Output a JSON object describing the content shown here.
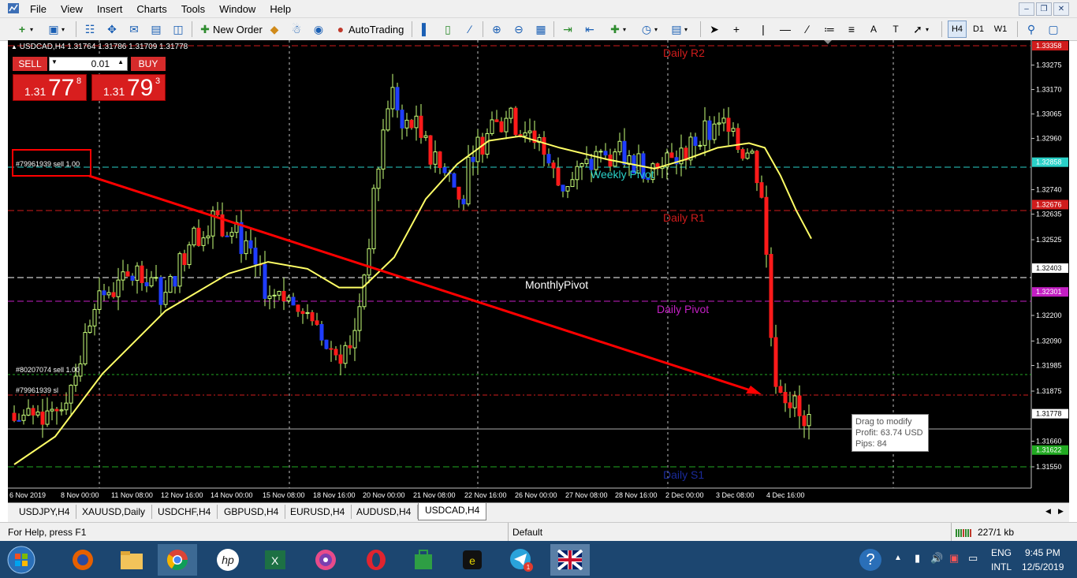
{
  "menu": [
    "File",
    "View",
    "Insert",
    "Charts",
    "Tools",
    "Window",
    "Help"
  ],
  "toolbar": {
    "new_order": "New Order",
    "autotrading": "AutoTrading",
    "timeframes": [
      "H4",
      "D1",
      "W1"
    ]
  },
  "chart": {
    "header": "USDCAD,H4  1.31764 1.31786 1.31709 1.31778",
    "trade_panel": {
      "sell_label": "SELL",
      "buy_label": "BUY",
      "lot": "0.01",
      "sell_small": "1.31",
      "sell_big": "77",
      "sell_sup": "8",
      "buy_small": "1.31",
      "buy_big": "79",
      "buy_sup": "3"
    },
    "order_labels": {
      "sell1": "#79961939 sell 1.00",
      "sell2": "#80207074 sell 1.00",
      "sl": "#79961939 sl"
    },
    "level_labels": {
      "daily_r2": "Daily R2",
      "weekly_pivot": "Weekly Pivot",
      "daily_r1": "Daily R1",
      "monthly_pivot": "MonthlyPivot",
      "daily_pivot": "Daily Pivot",
      "daily_s1": "Daily S1"
    },
    "price_axis": [
      "1.33358",
      "1.33275",
      "1.33170",
      "1.33065",
      "1.32960",
      "1.32858",
      "1.32740",
      "1.32676",
      "1.32635",
      "1.32525",
      "1.32403",
      "1.32301",
      "1.32200",
      "1.32090",
      "1.31985",
      "1.31875",
      "1.31778",
      "1.31660",
      "1.31622",
      "1.31550"
    ],
    "time_axis": [
      "6 Nov 2019",
      "8 Nov 00:00",
      "11 Nov 08:00",
      "12 Nov 16:00",
      "14 Nov 00:00",
      "15 Nov 08:00",
      "18 Nov 16:00",
      "20 Nov 00:00",
      "21 Nov 08:00",
      "22 Nov 16:00",
      "26 Nov 00:00",
      "27 Nov 08:00",
      "28 Nov 16:00",
      "2 Dec 00:00",
      "3 Dec 08:00",
      "4 Dec 16:00"
    ],
    "tooltip": {
      "line1": "Drag to modify",
      "line2": "Profit: 63.74 USD",
      "line3": "Pips: 84"
    },
    "colors": {
      "background": "#000000",
      "bull": "#c8ff7a",
      "bear_red": "#ff1a1a",
      "bear_blue": "#1f3dff",
      "ma": "#ffff66",
      "arrow": "#ff0000",
      "r_levels": "#d01c1c",
      "daily_pivot": "#c31fc3",
      "weekly_pivot": "#2ad1c8",
      "s_levels": "#22aa22"
    }
  },
  "tabs": [
    "USDJPY,H4",
    "XAUUSD,Daily",
    "USDCHF,H4",
    "GBPUSD,H4",
    "EURUSD,H4",
    "AUDUSD,H4",
    "USDCAD,H4"
  ],
  "status": {
    "help": "For Help, press F1",
    "profile": "Default",
    "traffic": "227/1 kb"
  },
  "taskbar": {
    "lang": "ENG",
    "layout": "INTL",
    "time": "9:45 PM",
    "date": "12/5/2019"
  }
}
